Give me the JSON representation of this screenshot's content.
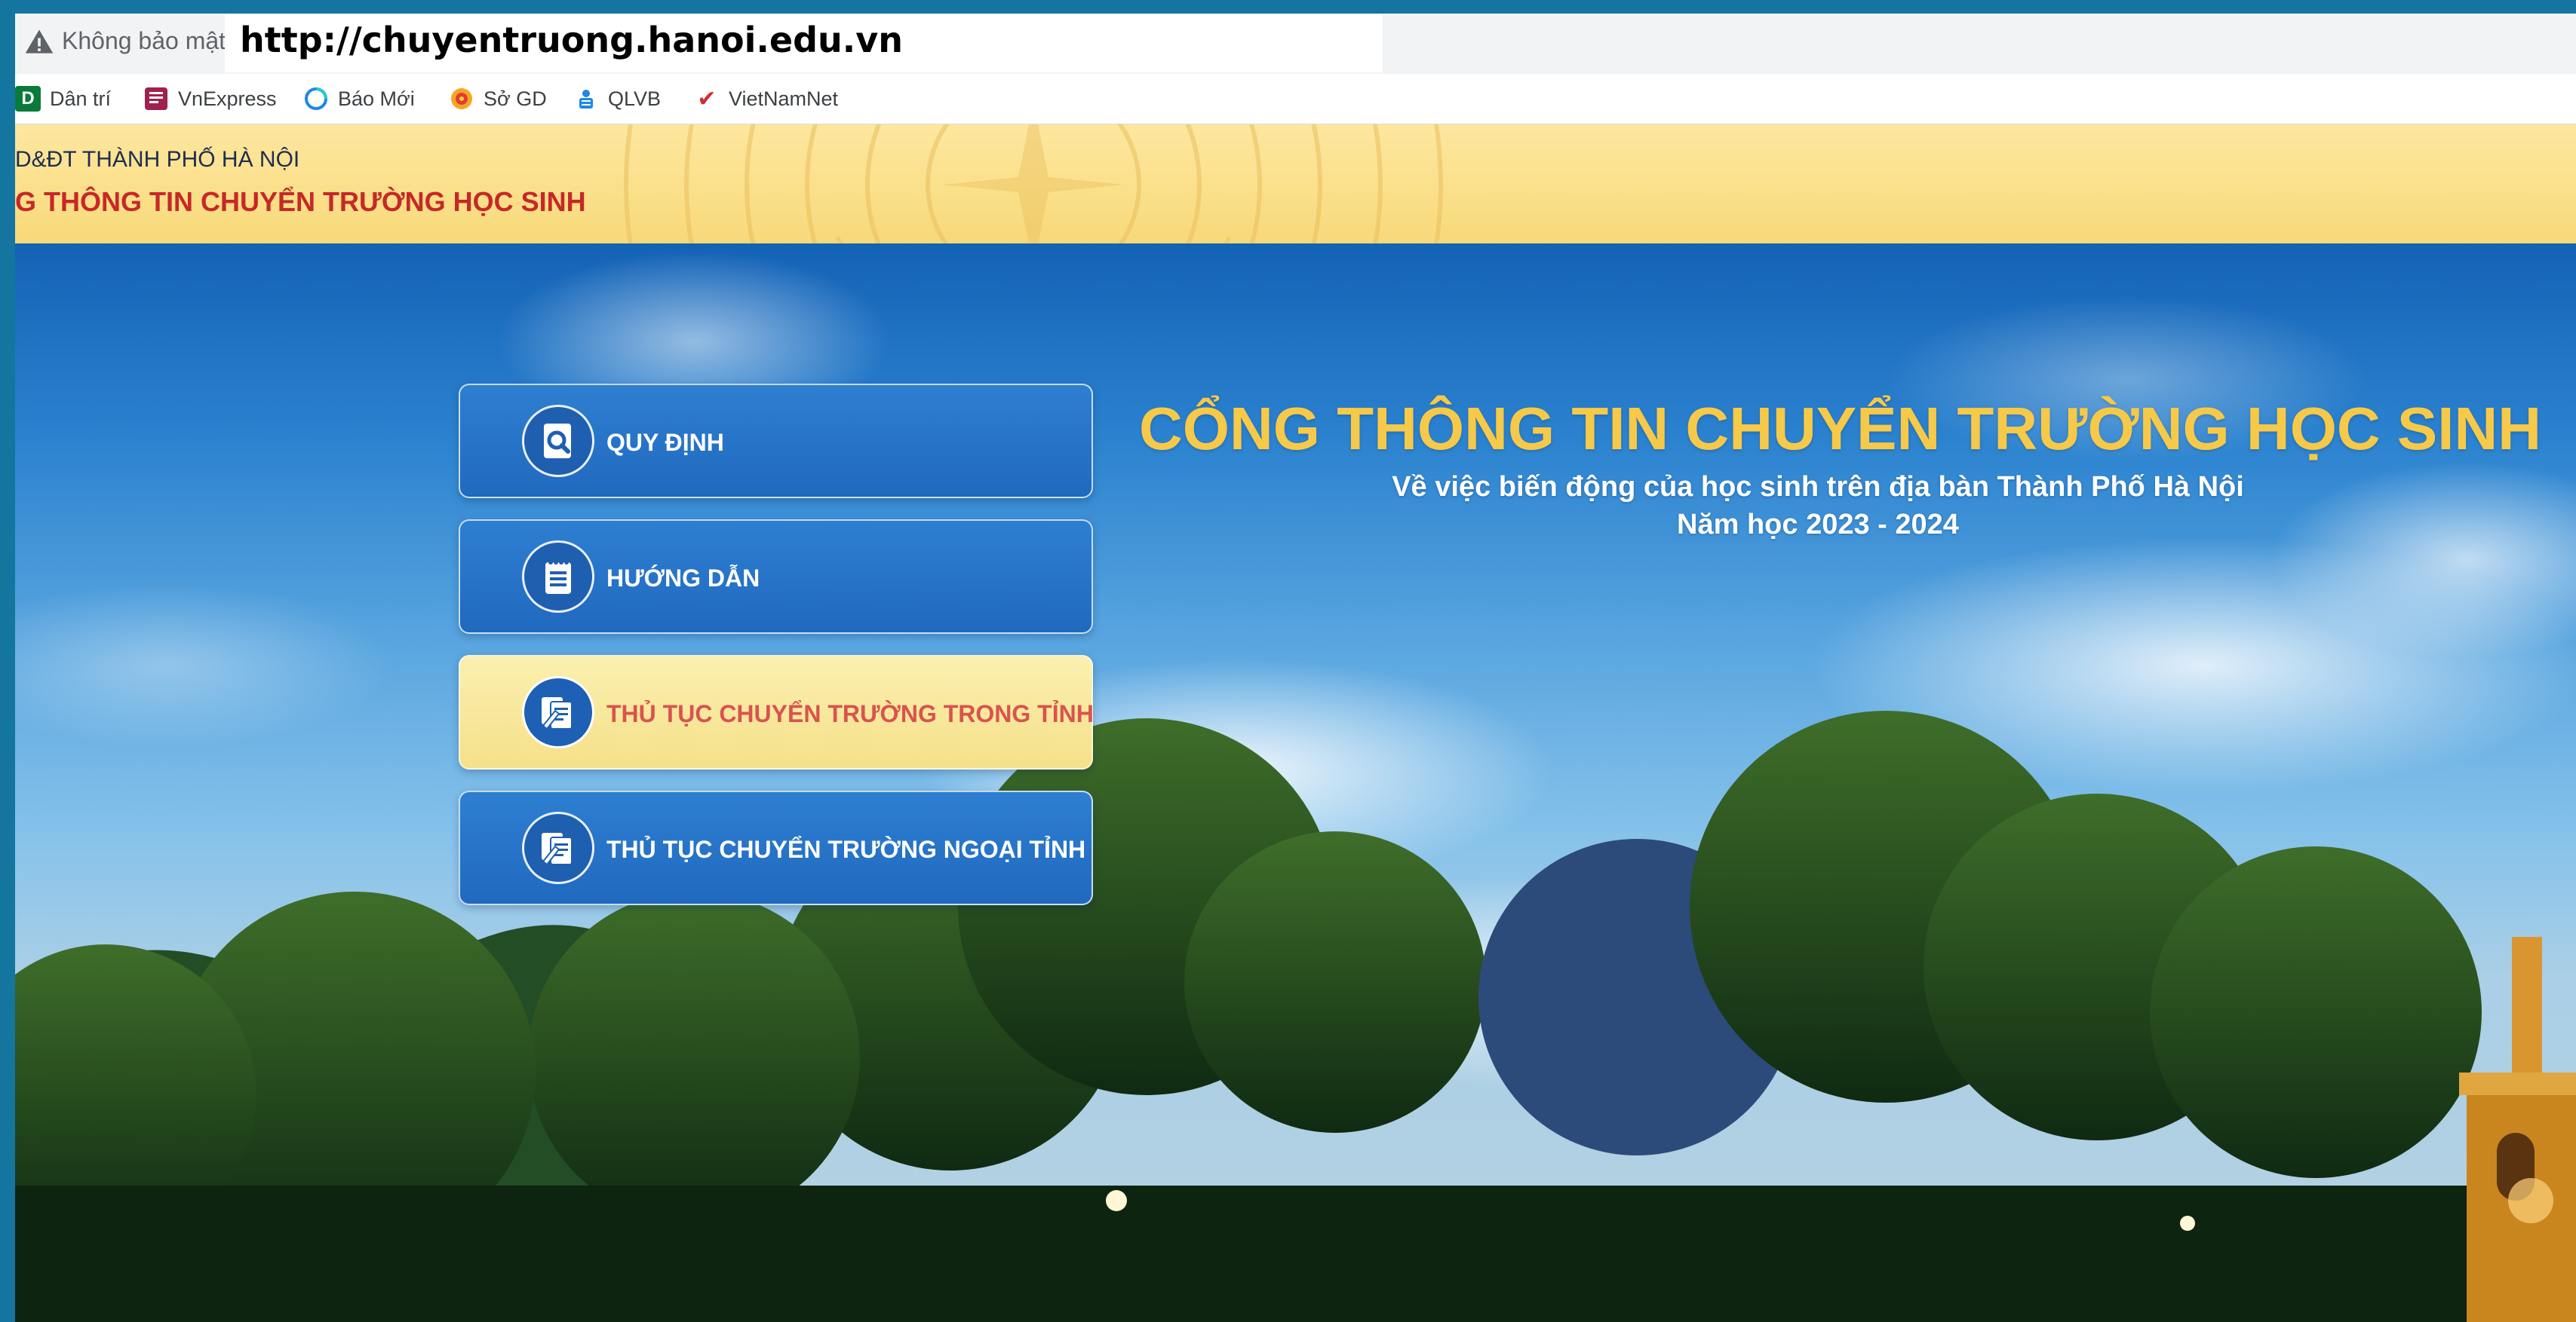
{
  "browser": {
    "security_label": "Không bảo mật",
    "url": "http://chuyentruong.hanoi.edu.vn",
    "bookmarks": [
      {
        "label": "Dân trí",
        "icon": "dantri-icon",
        "glyph": "D",
        "color": "#0a7a3b"
      },
      {
        "label": "VnExpress",
        "icon": "vnexpress-icon",
        "glyph": "",
        "color": "#9f224e"
      },
      {
        "label": "Báo Mới",
        "icon": "baomoi-icon",
        "glyph": "",
        "color": "#1e88e5"
      },
      {
        "label": "Sở GD",
        "icon": "sogd-icon",
        "glyph": "",
        "color": "#f5a623"
      },
      {
        "label": "QLVB",
        "icon": "qlvb-icon",
        "glyph": "",
        "color": "#1e88e5"
      },
      {
        "label": "VietNamNet",
        "icon": "vietnamnet-icon",
        "glyph": "✔",
        "color": "#d32f2f"
      }
    ]
  },
  "header": {
    "org": "D&ĐT THÀNH PHỐ HÀ NỘI",
    "portal": "G THÔNG TIN CHUYỂN TRƯỜNG HỌC SINH"
  },
  "menu": [
    {
      "label": "QUY ĐỊNH",
      "icon": "search-document-icon",
      "active": false
    },
    {
      "label": "HƯỚNG DẪN",
      "icon": "notepad-icon",
      "active": false
    },
    {
      "label": "THỦ TỤC CHUYỂN TRƯỜNG TRONG TỈNH",
      "icon": "document-pen-icon",
      "active": true
    },
    {
      "label": "THỦ TỤC CHUYỂN TRƯỜNG NGOẠI TỈNH",
      "icon": "document-pen-icon",
      "active": false
    }
  ],
  "hero": {
    "title": "CỔNG THÔNG TIN CHUYỂN TRƯỜNG HỌC SINH",
    "subtitle": "Về việc biến động của học sinh trên địa bàn Thành Phố Hà Nội",
    "school_year": "Năm học 2023 - 2024"
  },
  "colors": {
    "accent_gold": "#f7c948",
    "primary_blue": "#2069bf",
    "active_text": "#d9534f",
    "header_red": "#c62828"
  }
}
